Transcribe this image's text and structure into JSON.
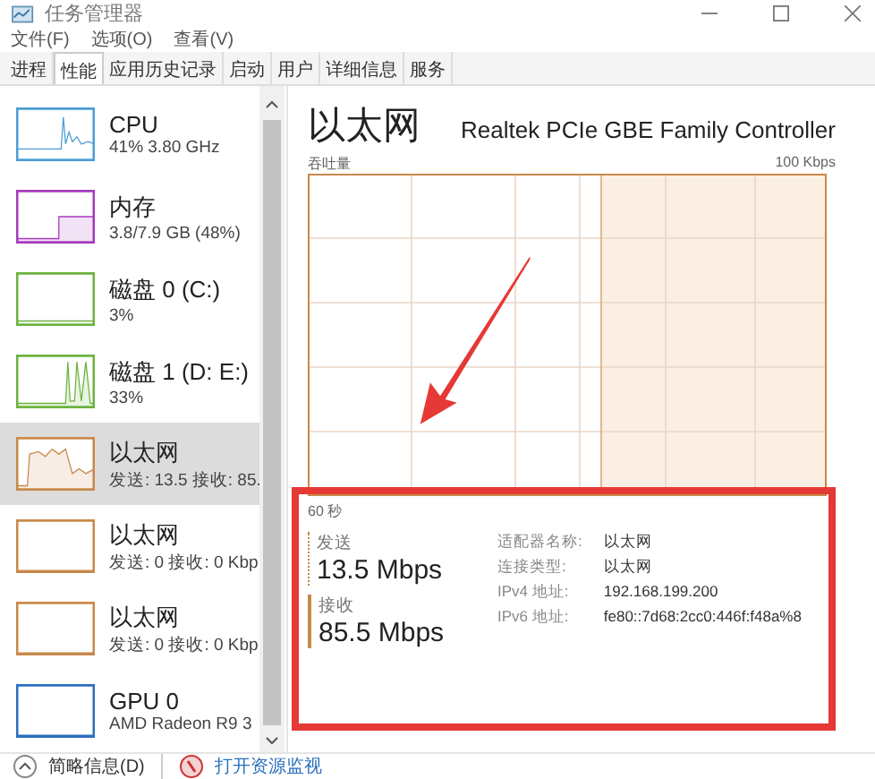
{
  "window": {
    "title": "任务管理器"
  },
  "menu": [
    "文件(F)",
    "选项(O)",
    "查看(V)"
  ],
  "tabs": [
    {
      "label": "进程",
      "selected": false
    },
    {
      "label": "性能",
      "selected": true
    },
    {
      "label": "应用历史记录",
      "selected": false
    },
    {
      "label": "启动",
      "selected": false
    },
    {
      "label": "用户",
      "selected": false
    },
    {
      "label": "详细信息",
      "selected": false
    },
    {
      "label": "服务",
      "selected": false
    }
  ],
  "sidebar": {
    "items": [
      {
        "kind": "cpu",
        "name": "CPU",
        "detail": "41% 3.80 GHz",
        "color": "#4a9ed6",
        "selected": false
      },
      {
        "kind": "memory",
        "name": "内存",
        "detail": "3.8/7.9 GB (48%)",
        "color": "#a63bbf",
        "selected": false
      },
      {
        "kind": "disk",
        "name": "磁盘 0 (C:)",
        "detail": "3%",
        "color": "#6cb33f",
        "selected": false
      },
      {
        "kind": "disk-busy",
        "name": "磁盘 1 (D: E:)",
        "detail": "33%",
        "color": "#6cb33f",
        "selected": false
      },
      {
        "kind": "network-busy",
        "name": "以太网",
        "detail": "发送: 13.5 接收: 85.",
        "color": "#c8894a",
        "selected": true
      },
      {
        "kind": "network",
        "name": "以太网",
        "detail": "发送: 0 接收: 0 Kbp",
        "color": "#c8894a",
        "selected": false
      },
      {
        "kind": "network",
        "name": "以太网",
        "detail": "发送: 0 接收: 0 Kbp",
        "color": "#c8894a",
        "selected": false
      },
      {
        "kind": "gpu",
        "name": "GPU 0",
        "detail": "AMD Radeon R9 3",
        "color": "#2b6fbf",
        "selected": false
      }
    ]
  },
  "footer": {
    "summary": "简略信息(D)",
    "monitor": "打开资源监视"
  },
  "detail": {
    "title": "以太网",
    "adapter": "Realtek PCIe GBE Family Controller",
    "chart_label": "吞吐量",
    "chart_max": "100 Kbps",
    "chart_span": "60 秒",
    "send": {
      "label": "发送",
      "value": "13.5 Mbps"
    },
    "receive": {
      "label": "接收",
      "value": "85.5 Mbps"
    },
    "info": [
      {
        "label": "适配器名称:",
        "value": "以太网"
      },
      {
        "label": "连接类型:",
        "value": "以太网"
      },
      {
        "label": "IPv4 地址:",
        "value": "192.168.199.200"
      },
      {
        "label": "IPv6 地址:",
        "value": "fe80::7d68:2cc0:446f:f48a%8"
      }
    ]
  }
}
